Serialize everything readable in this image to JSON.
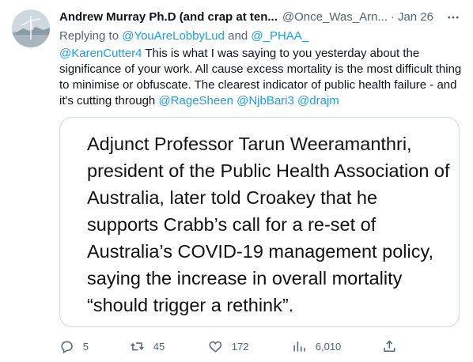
{
  "tweet": {
    "author": {
      "display_name": "Andrew Murray Ph.D (and crap at ten...",
      "handle": "@Once_Was_Arn...",
      "separator": "·",
      "date": "Jan 26"
    },
    "more_icon": "more-horizontal-icon",
    "reply_prefix": "Replying to",
    "reply_to": [
      "@YouAreLobbyLud",
      "@_PHAA_"
    ],
    "reply_joiner": "and",
    "body": {
      "lead_mention": "@KarenCutter4",
      "text": "This is what I was saying to you yesterday about the significance of your work. All cause excess mortality is the most difficult thing to minimise or obfuscate. The clearest indicator of public health failure - and it's cutting through",
      "trailing_mentions": [
        "@RageSheen",
        "@NjbBari3",
        "@drajm"
      ]
    },
    "media_text": "Adjunct Professor Tarun Weeramanthri, president of the Public Health Association of Australia, later told Croakey that he supports Crabb’s call for a re-set of Australia’s COVID-19 management policy, saying the increase in overall mortality “should trigger a rethink”.",
    "actions": {
      "reply": {
        "icon": "reply-icon",
        "count": "5"
      },
      "retweet": {
        "icon": "retweet-icon",
        "count": "45"
      },
      "like": {
        "icon": "heart-icon",
        "count": "172"
      },
      "views": {
        "icon": "views-icon",
        "count": "6,010"
      },
      "share": {
        "icon": "share-icon"
      }
    },
    "colors": {
      "link": "#1d9bf0",
      "secondary_text": "#536471",
      "primary_text": "#0f1419",
      "border": "#cfd9de"
    }
  }
}
